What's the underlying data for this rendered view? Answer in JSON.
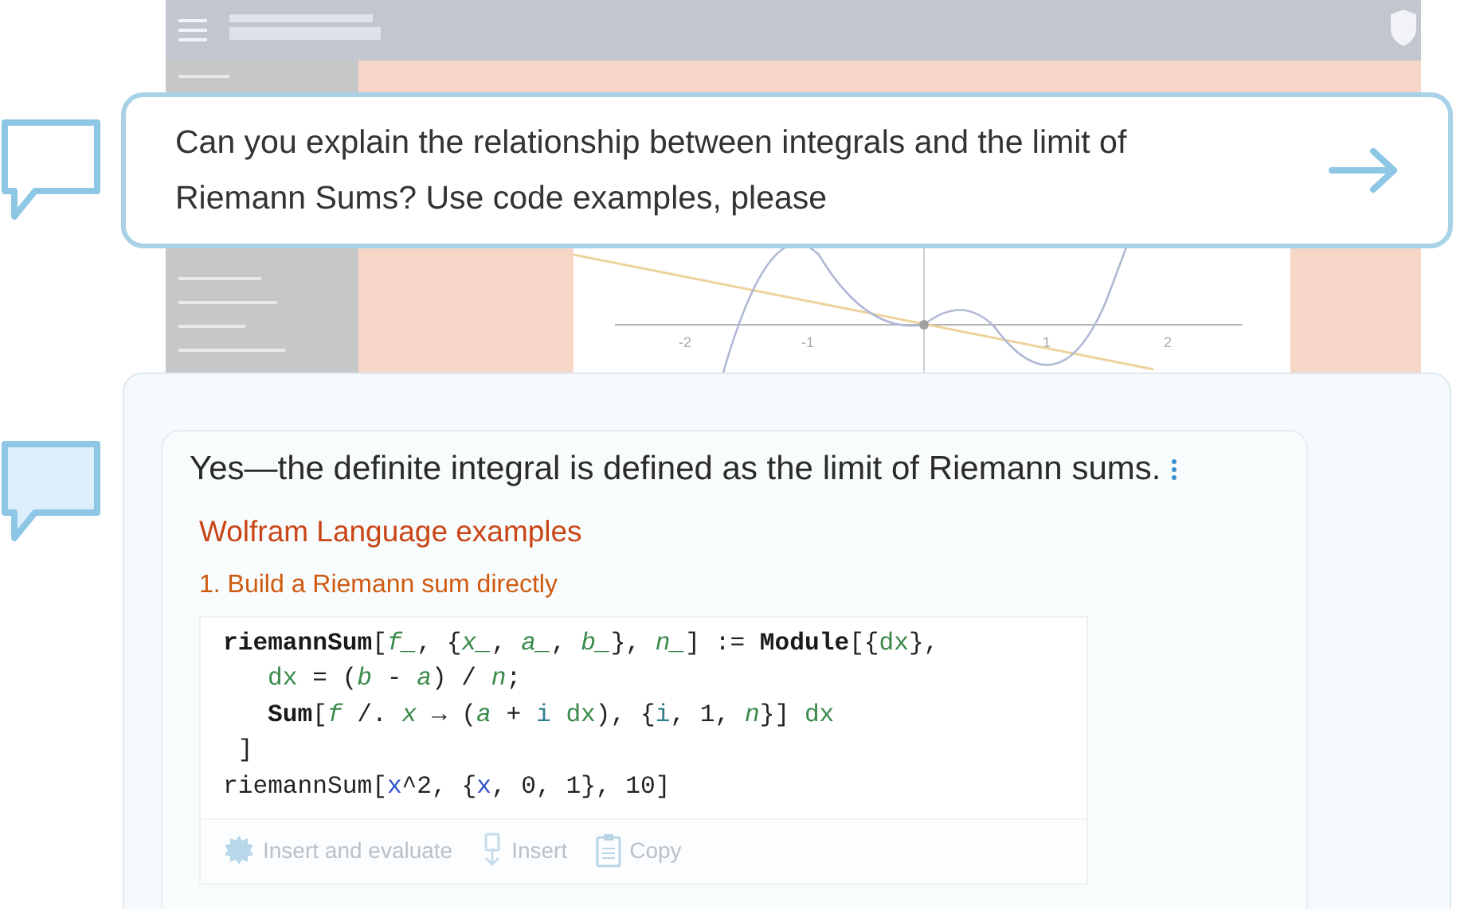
{
  "background_app": {
    "axis_labels": [
      "-2",
      "-1",
      "1",
      "2"
    ]
  },
  "question": {
    "text": "Can you explain the relationship between integrals and the limit of Riemann Sums? Use code examples, please"
  },
  "answer": {
    "summary": "Yes—the definite integral is defined as the limit of Riemann sums.",
    "section_title": "Wolfram Language examples",
    "step_title": "1. Build a Riemann sum directly",
    "code_lines": [
      {
        "indented": false,
        "tokens": [
          {
            "text": "riemannSum",
            "kind": "kw"
          },
          {
            "text": "[",
            "kind": "punct"
          },
          {
            "text": "f_",
            "kind": "pat"
          },
          {
            "text": ", {",
            "kind": "punct"
          },
          {
            "text": "x_",
            "kind": "pat"
          },
          {
            "text": ", ",
            "kind": "punct"
          },
          {
            "text": "a_",
            "kind": "pat"
          },
          {
            "text": ", ",
            "kind": "punct"
          },
          {
            "text": "b_",
            "kind": "pat"
          },
          {
            "text": "}, ",
            "kind": "punct"
          },
          {
            "text": "n_",
            "kind": "pat"
          },
          {
            "text": "] := ",
            "kind": "punct"
          },
          {
            "text": "Module",
            "kind": "kw"
          },
          {
            "text": "[{",
            "kind": "punct"
          },
          {
            "text": "dx",
            "kind": "local"
          },
          {
            "text": "},",
            "kind": "punct"
          }
        ]
      },
      {
        "indented": true,
        "tokens": [
          {
            "text": "dx",
            "kind": "local"
          },
          {
            "text": " = (",
            "kind": "punct"
          },
          {
            "text": "b",
            "kind": "pat"
          },
          {
            "text": " - ",
            "kind": "punct"
          },
          {
            "text": "a",
            "kind": "pat"
          },
          {
            "text": ") / ",
            "kind": "punct"
          },
          {
            "text": "n",
            "kind": "pat"
          },
          {
            "text": ";",
            "kind": "punct"
          }
        ]
      },
      {
        "indented": true,
        "tokens": [
          {
            "text": "Sum",
            "kind": "kw"
          },
          {
            "text": "[",
            "kind": "punct"
          },
          {
            "text": "f",
            "kind": "pat"
          },
          {
            "text": " /. ",
            "kind": "punct"
          },
          {
            "text": "x",
            "kind": "pat"
          },
          {
            "text": " → (",
            "kind": "punct"
          },
          {
            "text": "a",
            "kind": "pat"
          },
          {
            "text": " + ",
            "kind": "punct"
          },
          {
            "text": "i ",
            "kind": "iter"
          },
          {
            "text": "dx",
            "kind": "local"
          },
          {
            "text": "), {",
            "kind": "punct"
          },
          {
            "text": "i",
            "kind": "iter"
          },
          {
            "text": ", 1, ",
            "kind": "punct"
          },
          {
            "text": "n",
            "kind": "pat"
          },
          {
            "text": "}] ",
            "kind": "punct"
          },
          {
            "text": "dx",
            "kind": "local"
          }
        ]
      },
      {
        "indented": false,
        "tokens": [
          {
            "text": " ]",
            "kind": "punct"
          }
        ]
      },
      {
        "indented": false,
        "tokens": [
          {
            "text": "riemannSum",
            "kind": "punct"
          },
          {
            "text": "[",
            "kind": "punct"
          },
          {
            "text": "x",
            "kind": "global"
          },
          {
            "text": "^2, {",
            "kind": "punct"
          },
          {
            "text": "x",
            "kind": "global"
          },
          {
            "text": ", 0, 1}, 10]",
            "kind": "punct"
          }
        ]
      }
    ],
    "actions": [
      {
        "label": "Insert and evaluate",
        "kind": "evaluate"
      },
      {
        "label": "Insert",
        "kind": "insert"
      },
      {
        "label": "Copy",
        "kind": "copy"
      }
    ]
  }
}
